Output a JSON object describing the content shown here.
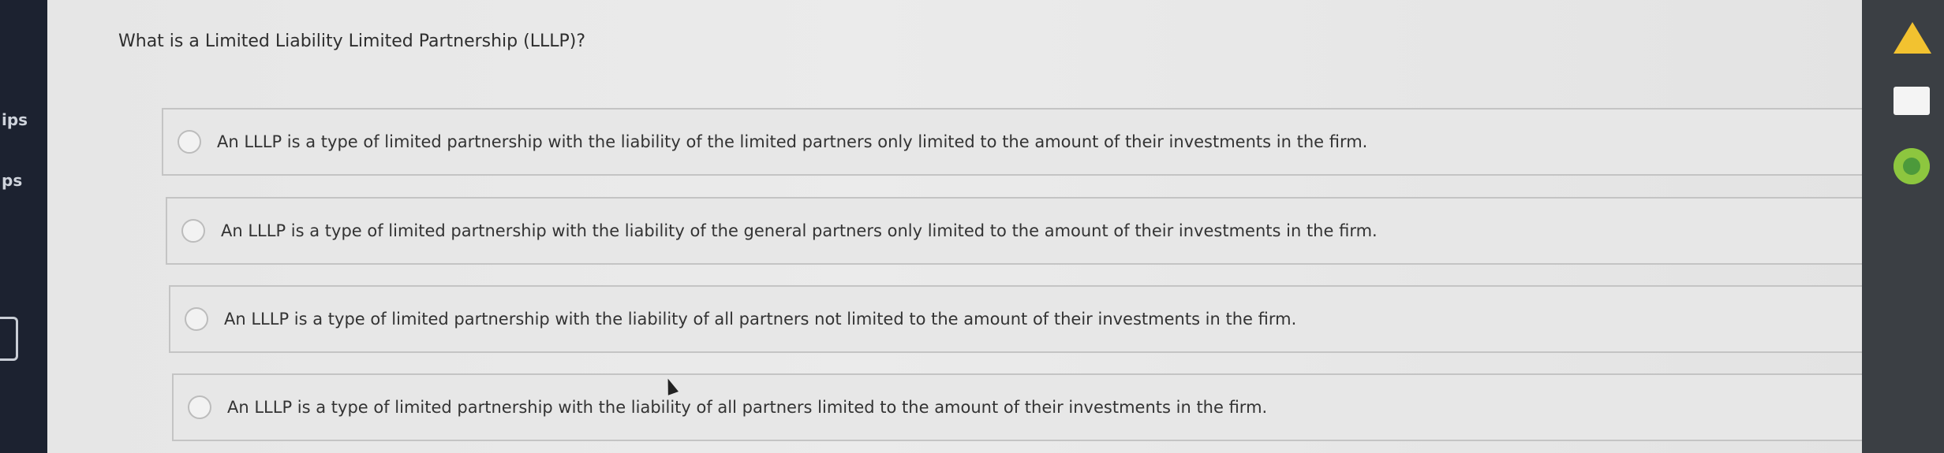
{
  "sidebar": {
    "labels": [
      "ips",
      "ps"
    ]
  },
  "question": {
    "text": "What is a Limited Liability Limited Partnership (LLLP)?"
  },
  "options": [
    {
      "label": "An LLLP is a type of limited partnership with the liability of the limited partners only limited to the amount of their investments in the firm."
    },
    {
      "label": "An LLLP is a type of limited partnership with the liability of the general partners only limited to the amount of their investments in the firm."
    },
    {
      "label": "An LLLP is a type of limited partnership with the liability of all partners not limited to the amount of their investments in the firm."
    },
    {
      "label": "An LLLP is a type of limited partnership with the liability of all partners limited to the amount of their investments in the firm."
    }
  ],
  "dock": {
    "icons": [
      "drive-icon",
      "docs-icon",
      "chrome-icon"
    ]
  }
}
